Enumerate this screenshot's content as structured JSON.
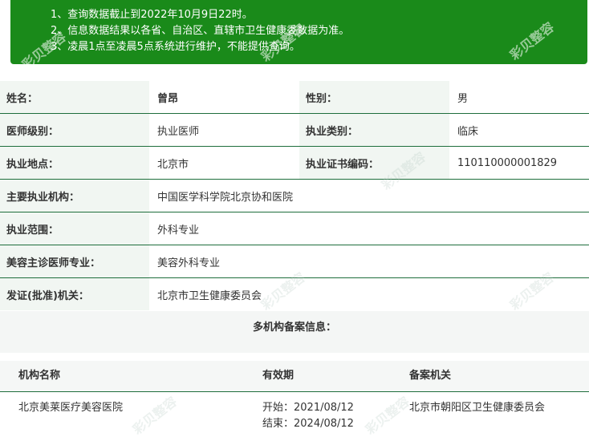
{
  "notice": {
    "lines": [
      "1、查询数据截止到2022年10月9日22时。",
      "2、信息数据结果以各省、自治区、直辖市卫生健康委数据为准。",
      "3、凌晨1点至凌晨5点系统进行维护，不能提供查询。"
    ]
  },
  "doctor": {
    "name_label": "姓名：",
    "name": "曾昂",
    "gender_label": "性别：",
    "gender": "男",
    "level_label": "医师级别：",
    "level": "执业医师",
    "category_label": "执业类别：",
    "category": "临床",
    "location_label": "执业地点：",
    "location": "北京市",
    "cert_label": "执业证书编码：",
    "cert": "110110000001829",
    "institution_label": "主要执业机构：",
    "institution": "中国医学科学院北京协和医院",
    "scope_label": "执业范围：",
    "scope": "外科专业",
    "cosmetic_label": "美容主诊医师专业：",
    "cosmetic": "美容外科专业",
    "authority_label": "发证(批准)机关：",
    "authority": "北京市卫生健康委员会"
  },
  "multi": {
    "title": "多机构备案信息：",
    "headers": [
      "机构名称",
      "有效期",
      "备案机关"
    ],
    "rows": [
      {
        "name": "北京美莱医疗美容医院",
        "start": "开始：2021/08/12",
        "end": "结束：2024/08/12",
        "authority": "北京市朝阳区卫生健康委员会"
      }
    ]
  },
  "watermark": "彩贝整容"
}
